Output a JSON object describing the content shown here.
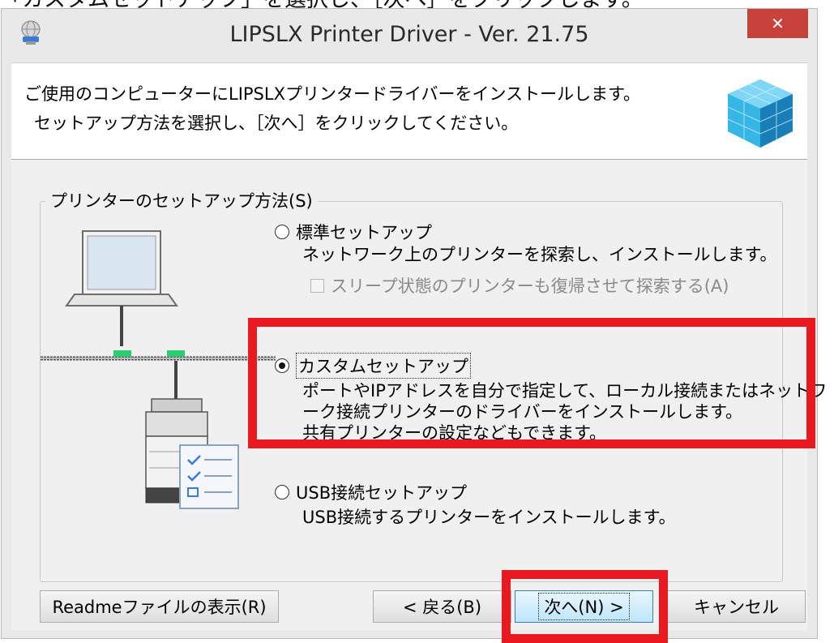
{
  "instruction_caption": "「カスタムセットアップ」を選択し、［次へ］をクリックします。",
  "window": {
    "title": "LIPSLX Printer Driver - Ver. 21.75",
    "close_glyph": "✕"
  },
  "header": {
    "line1": "ご使用のコンピューターにLIPSLXプリンタードライバーをインストールします。",
    "line2": "セットアップ方法を選択し、［次へ］をクリックしてください。"
  },
  "group": {
    "legend": "プリンターのセットアップ方法(S)"
  },
  "options": [
    {
      "label": "標準セットアップ",
      "selected": false,
      "description": [
        "ネットワーク上のプリンターを探索し、インストールします。"
      ]
    },
    {
      "label": "カスタムセットアップ",
      "selected": true,
      "description": [
        "ポートやIPアドレスを自分で指定して、ローカル接続またはネットワ",
        "ーク接続プリンターのドライバーをインストールします。",
        "共有プリンターの設定などもできます。"
      ]
    },
    {
      "label": "USB接続セットアップ",
      "selected": false,
      "description": [
        "USB接続するプリンターをインストールします。"
      ]
    }
  ],
  "sleep_checkbox": {
    "label": "スリープ状態のプリンターも復帰させて探索する(A)",
    "checked": false,
    "disabled": true
  },
  "buttons": {
    "readme": "Readmeファイルの表示(R)",
    "back": "< 戻る(B)",
    "next": "次へ(N) >",
    "cancel": "キャンセル"
  },
  "colors": {
    "highlight": "#e8191f",
    "close_button": "#c7423a",
    "network_link": "#2ecc71"
  },
  "icons": {
    "app": "installer-globe-icon",
    "cube": "blue-cube-icon",
    "laptop": "laptop-icon",
    "printer": "printer-icon",
    "checklist": "checklist-document-icon"
  }
}
